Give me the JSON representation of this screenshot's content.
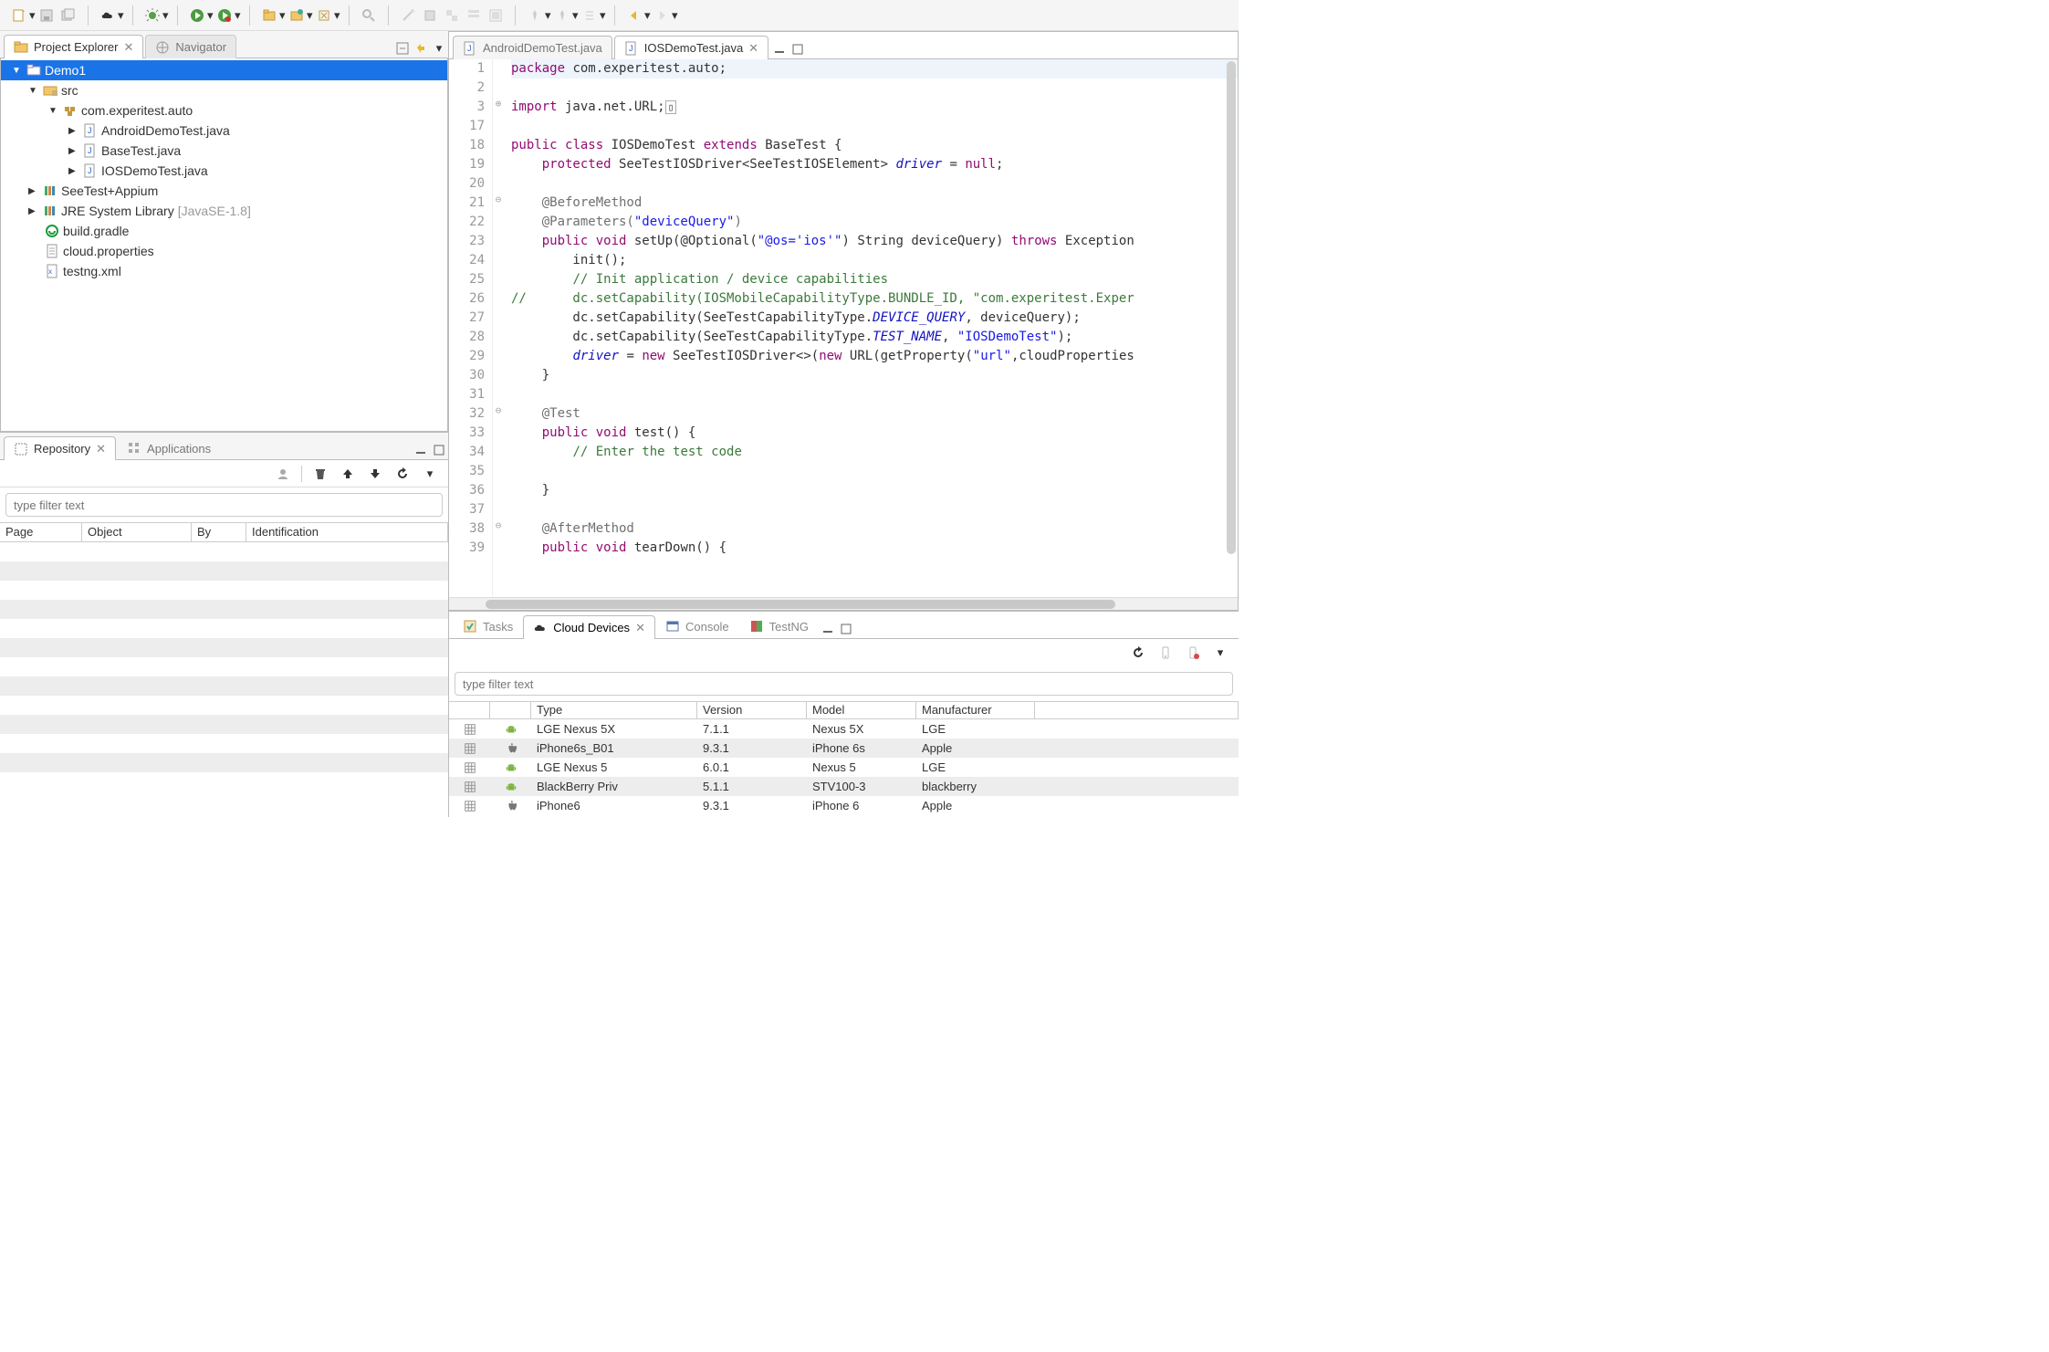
{
  "top_views": {
    "project_explorer": {
      "label": "Project Explorer"
    },
    "navigator": {
      "label": "Navigator"
    }
  },
  "project_tree": {
    "root": "Demo1",
    "src": "src",
    "pkg": "com.experitest.auto",
    "files": [
      "AndroidDemoTest.java",
      "BaseTest.java",
      "IOSDemoTest.java"
    ],
    "lib1": "SeeTest+Appium",
    "lib2": "JRE System Library",
    "lib2_deco": "[JavaSE-1.8]",
    "gradle": "build.gradle",
    "cloud": "cloud.properties",
    "testng": "testng.xml"
  },
  "repo": {
    "tab": "Repository",
    "apps_tab": "Applications",
    "filter_placeholder": "type filter text",
    "cols": [
      "Page",
      "Object",
      "By",
      "Identification"
    ]
  },
  "editor": {
    "tabs": [
      {
        "label": "AndroidDemoTest.java",
        "active": false
      },
      {
        "label": "IOSDemoTest.java",
        "active": true
      }
    ],
    "gutter": [
      "1",
      "2",
      "3",
      "17",
      "18",
      "19",
      "20",
      "21",
      "22",
      "23",
      "24",
      "25",
      "26",
      "27",
      "28",
      "29",
      "30",
      "31",
      "32",
      "33",
      "34",
      "35",
      "36",
      "37",
      "38",
      "39"
    ],
    "lines": {
      "l1a": "package",
      "l1b": " com.experitest.auto;",
      "l3a": "import",
      "l3b": " java.net.URL;",
      "l3c": "▯",
      "l18a": "public",
      "l18b": " ",
      "l18c": "class",
      "l18d": " IOSDemoTest ",
      "l18e": "extends",
      "l18f": " BaseTest {",
      "l19a": "    ",
      "l19b": "protected",
      "l19c": " SeeTestIOSDriver<SeeTestIOSElement> ",
      "l19d": "driver",
      "l19e": " = ",
      "l19f": "null",
      "l19g": ";",
      "l21a": "    @BeforeMethod",
      "l22a": "    @Parameters(",
      "l22b": "\"deviceQuery\"",
      "l22c": ")",
      "l23a": "    ",
      "l23b": "public",
      "l23c": " ",
      "l23d": "void",
      "l23e": " setUp(@Optional(",
      "l23f": "\"@os='ios'\"",
      "l23g": ") String deviceQuery) ",
      "l23h": "throws",
      "l23i": " Exception",
      "l24a": "        init();",
      "l25a": "        ",
      "l25b": "// Init application / device capabilities",
      "l26a": "//      dc.setCapability(IOSMobileCapabilityType.BUNDLE_ID, \"com.experitest.Exper",
      "l27a": "        dc.setCapability(SeeTestCapabilityType.",
      "l27b": "DEVICE_QUERY",
      "l27c": ", deviceQuery);",
      "l28a": "        dc.setCapability(SeeTestCapabilityType.",
      "l28b": "TEST_NAME",
      "l28c": ", ",
      "l28d": "\"IOSDemoTest\"",
      "l28e": ");",
      "l29a": "        ",
      "l29b": "driver",
      "l29c": " = ",
      "l29d": "new",
      "l29e": " SeeTestIOSDriver<>(",
      "l29f": "new",
      "l29g": " URL(getProperty(",
      "l29h": "\"url\"",
      "l29i": ",cloudProperties",
      "l30a": "    }",
      "l32a": "    @Test",
      "l33a": "    ",
      "l33b": "public",
      "l33c": " ",
      "l33d": "void",
      "l33e": " test() {",
      "l34a": "        ",
      "l34b": "// Enter the test code",
      "l36a": "    }",
      "l38a": "    @AfterMethod",
      "l39a": "    ",
      "l39b": "public",
      "l39c": " ",
      "l39d": "void",
      "l39e": " tearDown() {"
    }
  },
  "bottom": {
    "tabs": [
      "Tasks",
      "Cloud Devices",
      "Console",
      "TestNG"
    ],
    "filter_placeholder": "type filter text",
    "cols": [
      "",
      "",
      "Type",
      "Version",
      "Model",
      "Manufacturer"
    ],
    "rows": [
      {
        "os": "android",
        "type": "LGE Nexus 5X",
        "version": "7.1.1",
        "model": "Nexus 5X",
        "manufacturer": "LGE"
      },
      {
        "os": "ios",
        "type": "iPhone6s_B01",
        "version": "9.3.1",
        "model": "iPhone 6s",
        "manufacturer": "Apple"
      },
      {
        "os": "android",
        "type": "LGE Nexus 5",
        "version": "6.0.1",
        "model": "Nexus 5",
        "manufacturer": "LGE"
      },
      {
        "os": "android",
        "type": "BlackBerry Priv",
        "version": "5.1.1",
        "model": "STV100-3",
        "manufacturer": "blackberry"
      },
      {
        "os": "ios",
        "type": "iPhone6",
        "version": "9.3.1",
        "model": "iPhone 6",
        "manufacturer": "Apple"
      }
    ]
  }
}
